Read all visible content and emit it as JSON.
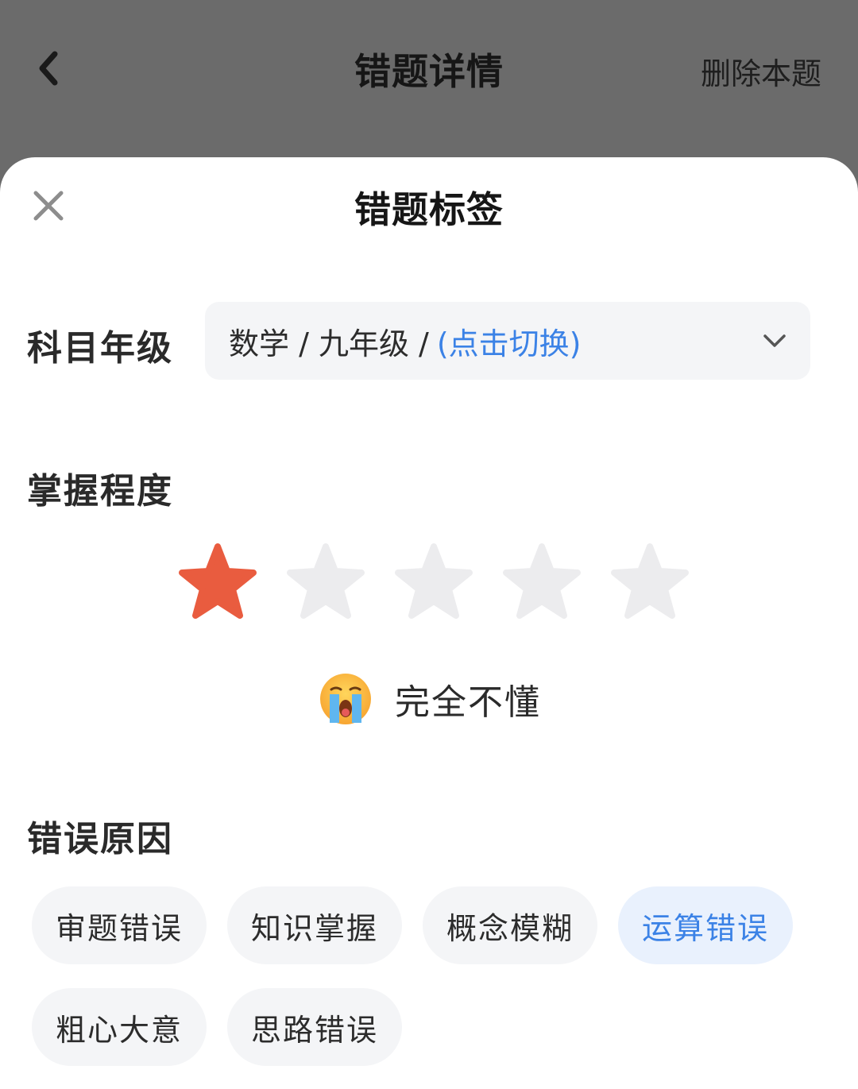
{
  "header": {
    "title": "错题详情",
    "delete_label": "删除本题"
  },
  "sheet": {
    "title": "错题标签",
    "subject_grade": {
      "label": "科目年级",
      "value": "数学 / 九年级 /",
      "switch_label": "(点击切换)"
    },
    "mastery": {
      "label": "掌握程度",
      "rating": 1,
      "max_rating": 5,
      "level_text": "完全不懂",
      "level_icon": "crying-face-icon"
    },
    "error_reasons": {
      "label": "错误原因",
      "options": [
        "审题错误",
        "知识掌握",
        "概念模糊",
        "运算错误",
        "粗心大意",
        "思路错误"
      ],
      "selected": "运算错误"
    }
  },
  "colors": {
    "star_active": "#e95c3f",
    "star_inactive": "#ececee",
    "accent": "#3b82e6",
    "chip_bg": "#f4f5f7",
    "chip_selected_bg": "#e9f1fd"
  }
}
